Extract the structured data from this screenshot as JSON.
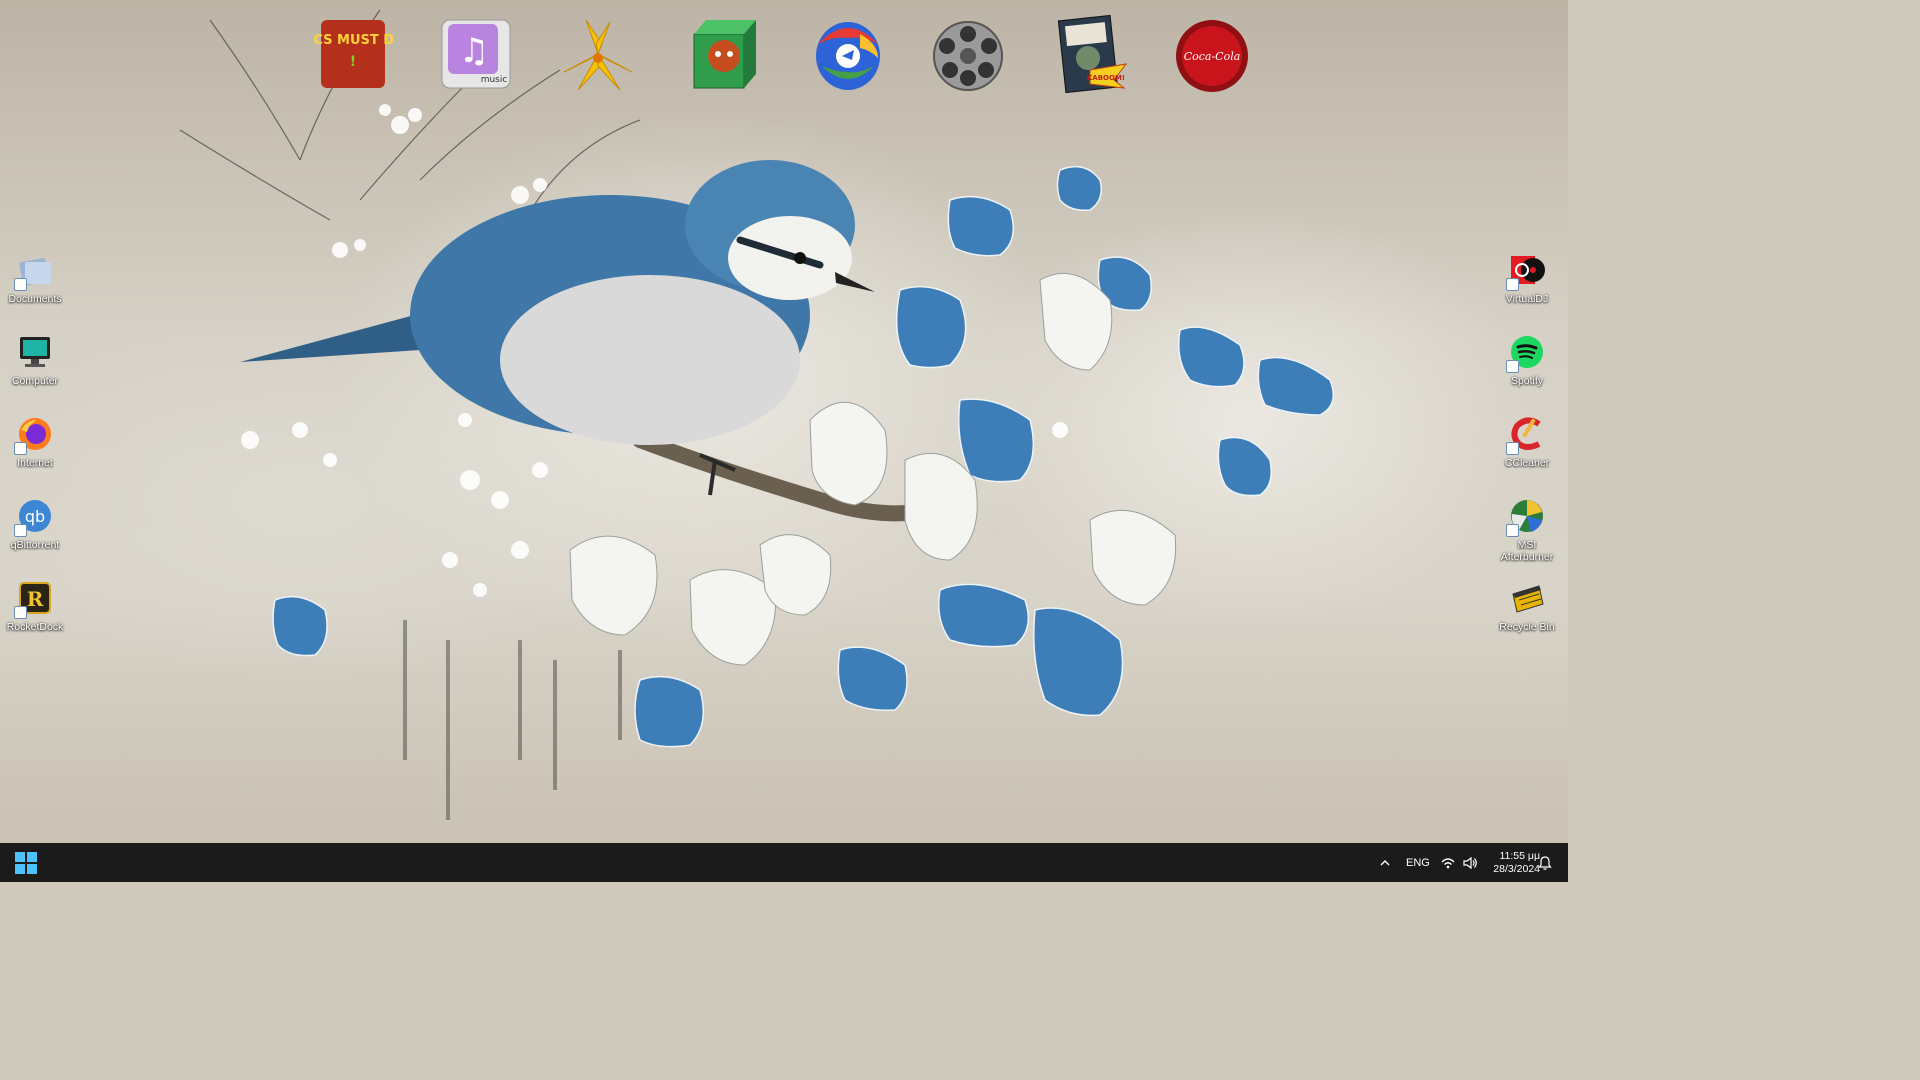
{
  "dock": {
    "items": [
      {
        "name": "Orcs Must Die!",
        "logo_text": "ORCS MUST DIE!",
        "icon": "orcs-must-die-icon"
      },
      {
        "name": "Music",
        "logo_text": "music",
        "icon": "music-folder-icon"
      },
      {
        "name": "Lily",
        "icon": "lily-flower-icon"
      },
      {
        "name": "Red panda box",
        "icon": "red-panda-box-icon"
      },
      {
        "name": "Browser",
        "icon": "browser-ball-icon"
      },
      {
        "name": "Film reel",
        "icon": "film-reel-icon"
      },
      {
        "name": "Comic book",
        "logo_text": "KABOOM!",
        "icon": "comic-book-icon"
      },
      {
        "name": "Coca-Cola",
        "logo_text": "Coca-Cola",
        "icon": "coca-cola-cap-icon"
      }
    ]
  },
  "desktop_left": [
    {
      "label": "Documents",
      "icon": "documents-icon"
    },
    {
      "label": "Computer",
      "icon": "computer-icon"
    },
    {
      "label": "Internet",
      "icon": "firefox-icon"
    },
    {
      "label": "qBittorrent",
      "icon": "qbittorrent-icon",
      "glyph_text": "qb"
    },
    {
      "label": "RocketDock",
      "icon": "rocketdock-icon",
      "glyph_text": "R"
    }
  ],
  "desktop_right": [
    {
      "label": "VirtualDJ",
      "icon": "virtualdj-icon"
    },
    {
      "label": "Spotify",
      "icon": "spotify-icon"
    },
    {
      "label": "CCleaner",
      "icon": "ccleaner-icon"
    },
    {
      "label": "MSI Afterburner",
      "icon": "msi-afterburner-icon"
    },
    {
      "label": "Recycle Bin",
      "icon": "recycle-bin-icon"
    }
  ],
  "taskbar": {
    "language": "ENG",
    "time": "11:55 μμ",
    "date": "28/3/2024"
  },
  "colors": {
    "taskbar_bg": "#1b1b1b",
    "start_accent": "#4cc2ff",
    "bird_blue": "#3f78a8"
  }
}
